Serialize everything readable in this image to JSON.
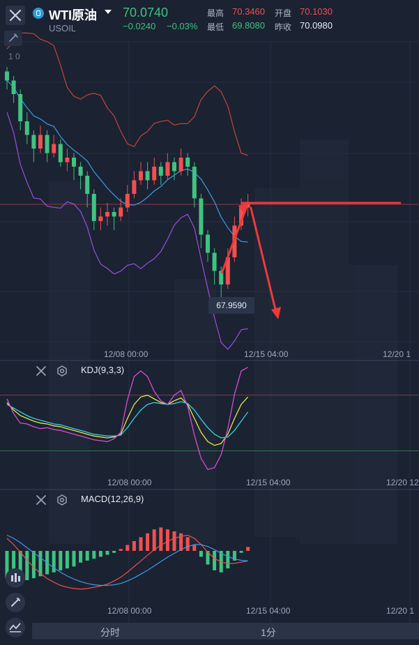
{
  "header": {
    "symbol_name": "WTI原油",
    "symbol_code": "USOIL",
    "price": "70.0740",
    "change": "−0.0240",
    "change_pct": "−0.03%",
    "stats": {
      "high_label": "最高",
      "high_value": "70.3460",
      "open_label": "开盘",
      "open_value": "70.1030",
      "low_label": "最低",
      "low_value": "69.8080",
      "prev_close_label": "昨收",
      "prev_close_value": "70.0980"
    },
    "mini_value": "1 0"
  },
  "colors": {
    "up": "#3fc380",
    "down": "#f0504f",
    "accent": "#2a9bd8",
    "bollinger_upper": "#c2463a",
    "bollinger_mid": "#3d9ce6",
    "bollinger_lower": "#9b4fe0",
    "kdj_k": "#e6e84a",
    "kdj_d": "#3ad1d8",
    "kdj_j": "#d64fd0"
  },
  "price_tooltip": "67.9590",
  "xaxis": {
    "main": [
      "12/08 00:00",
      "12/15 04:00",
      "12/20 1"
    ],
    "kdj": [
      "12/08 00:00",
      "12/15 04:00",
      "12/20 12"
    ],
    "macd": [
      "12/08 00:00",
      "12/15 04:00",
      "12/20 1"
    ]
  },
  "indicators": {
    "kdj_label": "KDJ(9,3,3)",
    "macd_label": "MACD(12,26,9)"
  },
  "bottom_bar": {
    "tab_timeshare": "分时",
    "tab_1min": "1分"
  },
  "chart_data": [
    {
      "type": "candlestick",
      "panel": "price",
      "ylim": [
        67.5,
        73.5
      ],
      "overlays": [
        "bollinger_upper",
        "bollinger_mid",
        "bollinger_lower"
      ],
      "reference_lines": [
        70.07
      ],
      "annotation_value": 67.959,
      "candles": [
        [
          73.0,
          72.8,
          73.1,
          72.6
        ],
        [
          72.8,
          72.5,
          72.9,
          72.3
        ],
        [
          72.5,
          71.9,
          72.6,
          71.7
        ],
        [
          71.9,
          71.6,
          72.1,
          71.4
        ],
        [
          71.6,
          71.3,
          71.7,
          71.0
        ],
        [
          71.3,
          71.6,
          71.8,
          71.2
        ],
        [
          71.6,
          71.2,
          71.7,
          71.0
        ],
        [
          71.2,
          71.4,
          71.6,
          71.1
        ],
        [
          71.4,
          71.0,
          71.5,
          70.9
        ],
        [
          71.0,
          71.1,
          71.3,
          70.8
        ],
        [
          71.1,
          70.9,
          71.2,
          70.6
        ],
        [
          70.9,
          70.7,
          71.0,
          70.4
        ],
        [
          70.7,
          70.3,
          70.8,
          70.0
        ],
        [
          70.3,
          69.7,
          70.4,
          69.5
        ],
        [
          69.7,
          69.8,
          70.0,
          69.5
        ],
        [
          69.8,
          69.9,
          70.1,
          69.6
        ],
        [
          69.9,
          69.8,
          70.0,
          69.5
        ],
        [
          69.8,
          70.0,
          70.2,
          69.7
        ],
        [
          70.0,
          70.3,
          70.5,
          69.9
        ],
        [
          70.3,
          70.6,
          70.8,
          70.2
        ],
        [
          70.6,
          70.8,
          71.0,
          70.5
        ],
        [
          70.8,
          70.6,
          71.0,
          70.4
        ],
        [
          70.6,
          70.9,
          71.1,
          70.5
        ],
        [
          70.9,
          70.7,
          71.0,
          70.5
        ],
        [
          70.7,
          71.0,
          71.2,
          70.6
        ],
        [
          71.0,
          70.8,
          71.1,
          70.6
        ],
        [
          70.8,
          71.1,
          71.3,
          70.7
        ],
        [
          71.1,
          70.9,
          71.2,
          70.7
        ],
        [
          70.9,
          70.2,
          71.0,
          70.0
        ],
        [
          70.2,
          69.4,
          70.3,
          69.1
        ],
        [
          69.4,
          69.0,
          69.5,
          68.8
        ],
        [
          69.0,
          68.6,
          69.1,
          68.3
        ],
        [
          68.6,
          68.3,
          68.7,
          68.0
        ],
        [
          68.3,
          68.9,
          69.1,
          68.2
        ],
        [
          68.9,
          69.6,
          69.8,
          68.8
        ],
        [
          69.6,
          70.0,
          70.2,
          69.5
        ],
        [
          70.0,
          70.1,
          70.3,
          69.8
        ]
      ]
    },
    {
      "type": "line",
      "panel": "kdj",
      "series": [
        {
          "name": "K",
          "values": [
            72,
            64,
            58,
            55,
            52,
            50,
            49,
            47,
            46,
            44,
            42,
            40,
            38,
            36,
            35,
            34,
            35,
            38,
            55,
            70,
            78,
            80,
            76,
            72,
            70,
            74,
            77,
            70,
            55,
            40,
            30,
            26,
            28,
            38,
            55,
            70,
            78
          ]
        },
        {
          "name": "D",
          "values": [
            70,
            66,
            62,
            58,
            55,
            53,
            51,
            49,
            48,
            46,
            44,
            42,
            40,
            38,
            37,
            36,
            36,
            37,
            45,
            55,
            64,
            70,
            72,
            71,
            70,
            71,
            73,
            71,
            64,
            54,
            45,
            38,
            34,
            35,
            42,
            52,
            62
          ]
        },
        {
          "name": "J",
          "values": [
            76,
            60,
            50,
            49,
            46,
            44,
            45,
            43,
            42,
            40,
            38,
            36,
            34,
            32,
            31,
            30,
            33,
            40,
            75,
            100,
            106,
            100,
            84,
            74,
            70,
            80,
            85,
            68,
            37,
            12,
            0,
            2,
            16,
            44,
            81,
            106,
            110
          ]
        }
      ]
    },
    {
      "type": "bar",
      "panel": "macd",
      "values": [
        -0.28,
        -0.3,
        -0.32,
        -0.3,
        -0.28,
        -0.26,
        -0.24,
        -0.22,
        -0.2,
        -0.18,
        -0.16,
        -0.12,
        -0.1,
        -0.08,
        -0.06,
        -0.04,
        -0.02,
        0.02,
        0.06,
        0.1,
        0.14,
        0.18,
        0.22,
        0.24,
        0.22,
        0.2,
        0.18,
        0.14,
        0.06,
        -0.06,
        -0.14,
        -0.2,
        -0.22,
        -0.18,
        -0.1,
        -0.02,
        0.04
      ],
      "series": [
        {
          "name": "DIF",
          "values": [
            -0.2,
            -0.3,
            -0.42,
            -0.55,
            -0.66,
            -0.76,
            -0.84,
            -0.9,
            -0.95,
            -0.98,
            -1.0,
            -1.01,
            -1.0,
            -0.98,
            -0.96,
            -0.93,
            -0.88,
            -0.82,
            -0.74,
            -0.65,
            -0.56,
            -0.47,
            -0.38,
            -0.31,
            -0.25,
            -0.2,
            -0.17,
            -0.15,
            -0.2,
            -0.3,
            -0.42,
            -0.52,
            -0.58,
            -0.6,
            -0.6,
            -0.58,
            -0.56
          ]
        },
        {
          "name": "DEA",
          "values": [
            -0.15,
            -0.2,
            -0.27,
            -0.35,
            -0.43,
            -0.51,
            -0.59,
            -0.67,
            -0.74,
            -0.8,
            -0.85,
            -0.89,
            -0.92,
            -0.94,
            -0.95,
            -0.95,
            -0.94,
            -0.92,
            -0.88,
            -0.83,
            -0.77,
            -0.71,
            -0.64,
            -0.57,
            -0.5,
            -0.44,
            -0.38,
            -0.33,
            -0.3,
            -0.3,
            -0.33,
            -0.38,
            -0.44,
            -0.49,
            -0.53,
            -0.55,
            -0.56
          ]
        }
      ]
    }
  ]
}
